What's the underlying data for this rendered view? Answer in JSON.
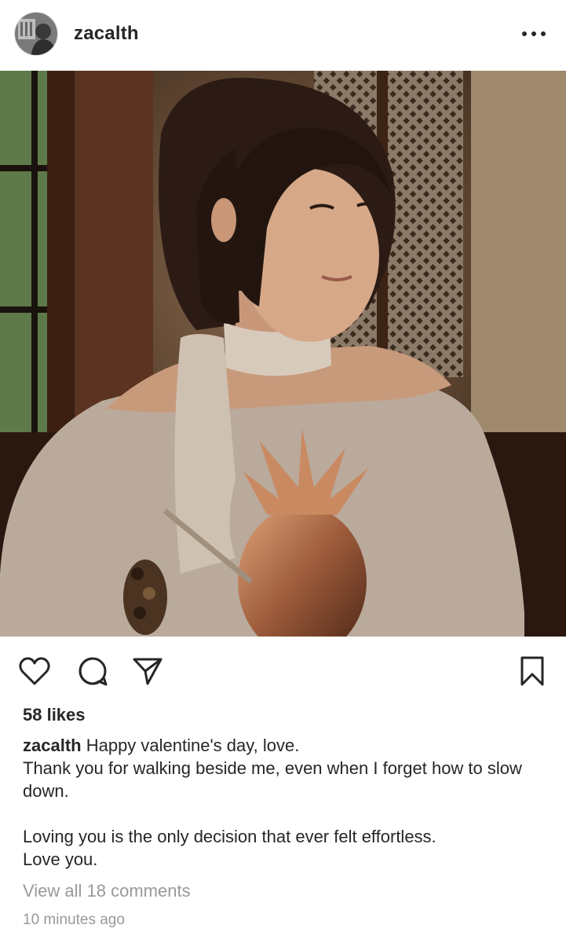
{
  "post": {
    "username": "zacalth",
    "likes": "58 likes",
    "caption": {
      "username": "zacalth",
      "line1": " Happy valentine's day, love.",
      "line2": "Thank you for walking beside me, even when I forget how to slow down.",
      "line3": "Loving you is the only decision that ever felt effortless.",
      "line4": "Love you."
    },
    "view_comments": "View all 18 comments",
    "timestamp": "10 minutes ago"
  },
  "icons": {
    "more": "more-options-icon",
    "like": "heart-icon",
    "comment": "comment-bubble-icon",
    "share": "paper-plane-icon",
    "save": "bookmark-icon"
  },
  "colors": {
    "text": "#262626",
    "muted": "#999999",
    "background": "#ffffff"
  }
}
